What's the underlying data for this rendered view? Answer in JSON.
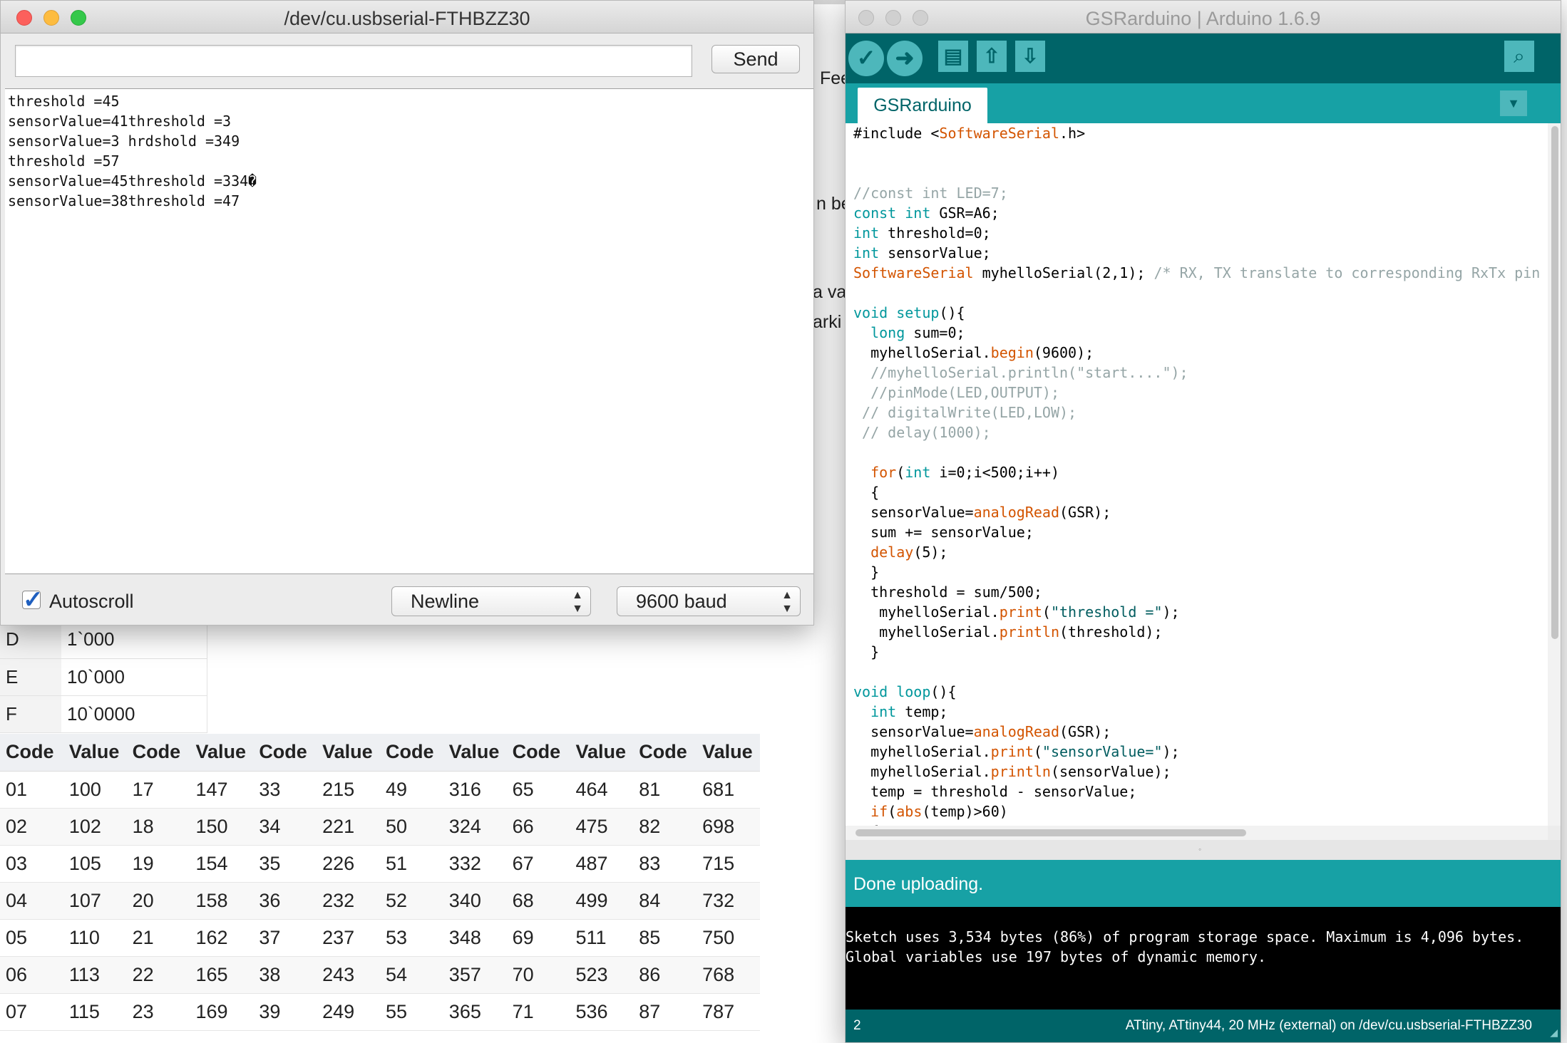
{
  "background_page": {
    "fragments": [
      {
        "id": "fee",
        "text": "Fee"
      },
      {
        "id": "on-be",
        "text": "n be"
      },
      {
        "id": "a-va",
        "text": "a va"
      },
      {
        "id": "arki",
        "text": "arki"
      }
    ],
    "letter_table": [
      {
        "code": "D",
        "value": "1`000"
      },
      {
        "code": "E",
        "value": "10`000"
      },
      {
        "code": "F",
        "value": "10`0000"
      }
    ],
    "code_table": {
      "headers": [
        "Code",
        "Value",
        "Code",
        "Value",
        "Code",
        "Value",
        "Code",
        "Value",
        "Code",
        "Value",
        "Code",
        "Value"
      ],
      "rows": [
        [
          "01",
          "100",
          "17",
          "147",
          "33",
          "215",
          "49",
          "316",
          "65",
          "464",
          "81",
          "681"
        ],
        [
          "02",
          "102",
          "18",
          "150",
          "34",
          "221",
          "50",
          "324",
          "66",
          "475",
          "82",
          "698"
        ],
        [
          "03",
          "105",
          "19",
          "154",
          "35",
          "226",
          "51",
          "332",
          "67",
          "487",
          "83",
          "715"
        ],
        [
          "04",
          "107",
          "20",
          "158",
          "36",
          "232",
          "52",
          "340",
          "68",
          "499",
          "84",
          "732"
        ],
        [
          "05",
          "110",
          "21",
          "162",
          "37",
          "237",
          "53",
          "348",
          "69",
          "511",
          "85",
          "750"
        ],
        [
          "06",
          "113",
          "22",
          "165",
          "38",
          "243",
          "54",
          "357",
          "70",
          "523",
          "86",
          "768"
        ],
        [
          "07",
          "115",
          "23",
          "169",
          "39",
          "249",
          "55",
          "365",
          "71",
          "536",
          "87",
          "787"
        ]
      ]
    }
  },
  "serial_monitor": {
    "title": "/dev/cu.usbserial-FTHBZZ30",
    "input_value": "",
    "send_label": "Send",
    "output_lines": [
      "threshold =45",
      "sensorValue=41threshold =3",
      "sensorValue=3 hrdshold =349",
      "threshold =57",
      "sensorValue=45threshold =334�",
      "sensorValue=38threshold =47"
    ],
    "autoscroll_label": "Autoscroll",
    "autoscroll_checked": true,
    "line_ending": "Newline",
    "baud_rate": "9600 baud"
  },
  "ide": {
    "title": "GSRarduino | Arduino 1.6.9",
    "toolbar": {
      "verify_icon": "check-icon",
      "upload_icon": "arrow-right-icon",
      "new_icon": "new-file-icon",
      "open_icon": "arrow-up-icon",
      "save_icon": "arrow-down-icon",
      "monitor_icon": "magnifier-icon"
    },
    "tab_label": "GSRarduino",
    "code_lines": [
      [
        {
          "t": "#include <",
          "c": ""
        },
        {
          "t": "SoftwareSerial",
          "c": "fn"
        },
        {
          "t": ".h>",
          "c": ""
        }
      ],
      [],
      [],
      [
        {
          "t": "//const int LED=7;",
          "c": "cm"
        }
      ],
      [
        {
          "t": "const",
          "c": "kw"
        },
        {
          "t": " ",
          "c": ""
        },
        {
          "t": "int",
          "c": "kw"
        },
        {
          "t": " GSR=A6;",
          "c": ""
        }
      ],
      [
        {
          "t": "int",
          "c": "kw"
        },
        {
          "t": " threshold=0;",
          "c": ""
        }
      ],
      [
        {
          "t": "int",
          "c": "kw"
        },
        {
          "t": " sensorValue;",
          "c": ""
        }
      ],
      [
        {
          "t": "SoftwareSerial",
          "c": "fn"
        },
        {
          "t": " myhelloSerial(2,1); ",
          "c": ""
        },
        {
          "t": "/* RX, TX translate to corresponding RxTx pin",
          "c": "cm"
        }
      ],
      [],
      [
        {
          "t": "void",
          "c": "kw"
        },
        {
          "t": " ",
          "c": ""
        },
        {
          "t": "setup",
          "c": "kw"
        },
        {
          "t": "(){",
          "c": ""
        }
      ],
      [
        {
          "t": "  ",
          "c": ""
        },
        {
          "t": "long",
          "c": "kw"
        },
        {
          "t": " sum=0;",
          "c": ""
        }
      ],
      [
        {
          "t": "  myhelloSerial.",
          "c": ""
        },
        {
          "t": "begin",
          "c": "fn"
        },
        {
          "t": "(9600);",
          "c": ""
        }
      ],
      [
        {
          "t": "  //myhelloSerial.println(\"start....\");",
          "c": "cm"
        }
      ],
      [
        {
          "t": "  //pinMode(LED,OUTPUT);",
          "c": "cm"
        }
      ],
      [
        {
          "t": " // digitalWrite(LED,LOW);",
          "c": "cm"
        }
      ],
      [
        {
          "t": " // delay(1000);",
          "c": "cm"
        }
      ],
      [],
      [
        {
          "t": "  ",
          "c": ""
        },
        {
          "t": "for",
          "c": "fn"
        },
        {
          "t": "(",
          "c": ""
        },
        {
          "t": "int",
          "c": "kw"
        },
        {
          "t": " i=0;i<500;i++)",
          "c": ""
        }
      ],
      [
        {
          "t": "  {",
          "c": ""
        }
      ],
      [
        {
          "t": "  sensorValue=",
          "c": ""
        },
        {
          "t": "analogRead",
          "c": "fn"
        },
        {
          "t": "(GSR);",
          "c": ""
        }
      ],
      [
        {
          "t": "  sum += sensorValue;",
          "c": ""
        }
      ],
      [
        {
          "t": "  ",
          "c": ""
        },
        {
          "t": "delay",
          "c": "fn"
        },
        {
          "t": "(5);",
          "c": ""
        }
      ],
      [
        {
          "t": "  }",
          "c": ""
        }
      ],
      [
        {
          "t": "  threshold = sum/500;",
          "c": ""
        }
      ],
      [
        {
          "t": "   myhelloSerial.",
          "c": ""
        },
        {
          "t": "print",
          "c": "fn"
        },
        {
          "t": "(",
          "c": ""
        },
        {
          "t": "\"threshold =\"",
          "c": "str"
        },
        {
          "t": ");",
          "c": ""
        }
      ],
      [
        {
          "t": "   myhelloSerial.",
          "c": ""
        },
        {
          "t": "println",
          "c": "fn"
        },
        {
          "t": "(threshold);",
          "c": ""
        }
      ],
      [
        {
          "t": "  }",
          "c": ""
        }
      ],
      [],
      [
        {
          "t": "void",
          "c": "kw"
        },
        {
          "t": " ",
          "c": ""
        },
        {
          "t": "loop",
          "c": "kw"
        },
        {
          "t": "(){",
          "c": ""
        }
      ],
      [
        {
          "t": "  ",
          "c": ""
        },
        {
          "t": "int",
          "c": "kw"
        },
        {
          "t": " temp;",
          "c": ""
        }
      ],
      [
        {
          "t": "  sensorValue=",
          "c": ""
        },
        {
          "t": "analogRead",
          "c": "fn"
        },
        {
          "t": "(GSR);",
          "c": ""
        }
      ],
      [
        {
          "t": "  myhelloSerial.",
          "c": ""
        },
        {
          "t": "print",
          "c": "fn"
        },
        {
          "t": "(",
          "c": ""
        },
        {
          "t": "\"sensorValue=\"",
          "c": "str"
        },
        {
          "t": ");",
          "c": ""
        }
      ],
      [
        {
          "t": "  myhelloSerial.",
          "c": ""
        },
        {
          "t": "println",
          "c": "fn"
        },
        {
          "t": "(sensorValue);",
          "c": ""
        }
      ],
      [
        {
          "t": "  temp = threshold - sensorValue;",
          "c": ""
        }
      ],
      [
        {
          "t": "  ",
          "c": ""
        },
        {
          "t": "if",
          "c": "fn"
        },
        {
          "t": "(",
          "c": ""
        },
        {
          "t": "abs",
          "c": "fn"
        },
        {
          "t": "(temp)>60)",
          "c": ""
        }
      ],
      [
        {
          "t": "  {",
          "c": ""
        }
      ]
    ],
    "status_message": "Done uploading.",
    "console_lines": [
      "Sketch uses 3,534 bytes (86%) of program storage space. Maximum is 4,096 bytes.",
      "Global variables use 197 bytes of dynamic memory."
    ],
    "line_number": "2",
    "board_info": "ATtiny, ATtiny44, 20 MHz (external) on /dev/cu.usbserial-FTHBZZ30"
  },
  "colors": {
    "arduino_dark": "#006468",
    "arduino_mid": "#17a1a5",
    "arduino_light": "#4db7bb",
    "keyword": "#00979c",
    "function": "#d35400",
    "comment": "#95a5a6",
    "mac_close": "#fc605c",
    "mac_minimize": "#fdbc40",
    "mac_zoom": "#34c84a"
  }
}
